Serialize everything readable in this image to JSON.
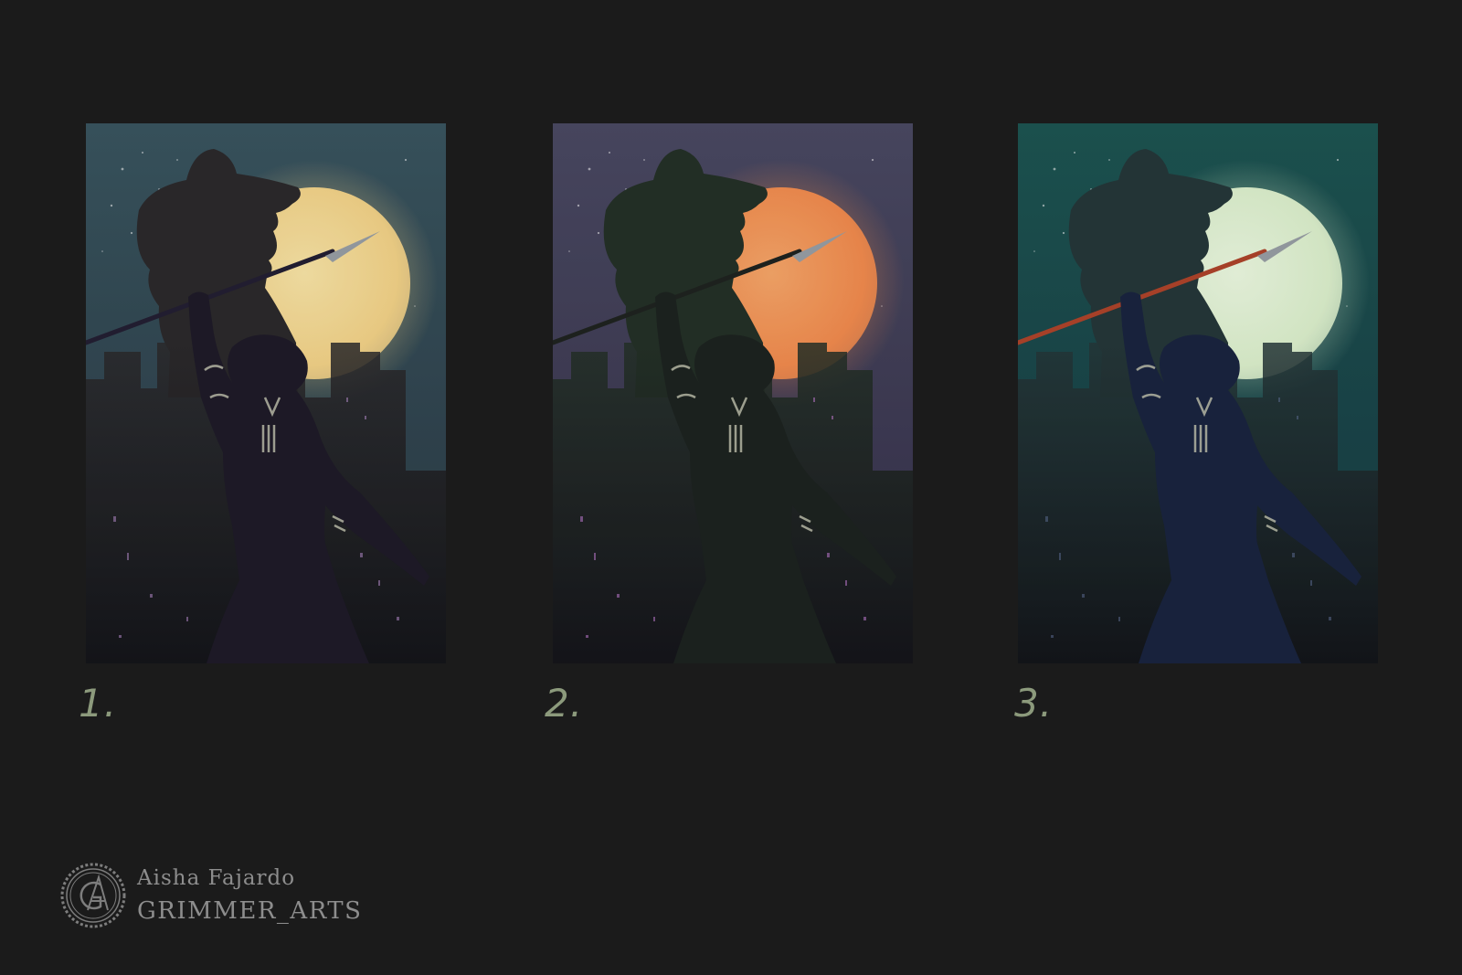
{
  "panels": [
    {
      "label": "1.",
      "palette": {
        "sky_top": "#3a5560",
        "sky_bottom": "#2a3a44",
        "moon": "#f6d58a",
        "moon_glow": "#fbe7a8",
        "silhouette": "#2c2a2c",
        "figure": "#1f1b29",
        "spear": "#241f33",
        "city_lights": "#b98fd0"
      }
    },
    {
      "label": "2.",
      "palette": {
        "sky_top": "#4b4a63",
        "sky_bottom": "#35304a",
        "moon": "#f58d4f",
        "moon_glow": "#f9a86a",
        "silhouette": "#253128",
        "figure": "#1d2420",
        "spear": "#1f2420",
        "city_lights": "#c77fd8"
      }
    },
    {
      "label": "3.",
      "palette": {
        "sky_top": "#1d5552",
        "sky_bottom": "#183a44",
        "moon": "#dff3cf",
        "moon_glow": "#eefbe3",
        "silhouette": "#26383a",
        "figure": "#1a2540",
        "spear": "#b0452b",
        "city_lights": "#5e6f95"
      }
    }
  ],
  "signature": {
    "name": "Aisha Fajardo",
    "handle": "GRIMMER_ARTS",
    "seal_monogram": "GA"
  }
}
